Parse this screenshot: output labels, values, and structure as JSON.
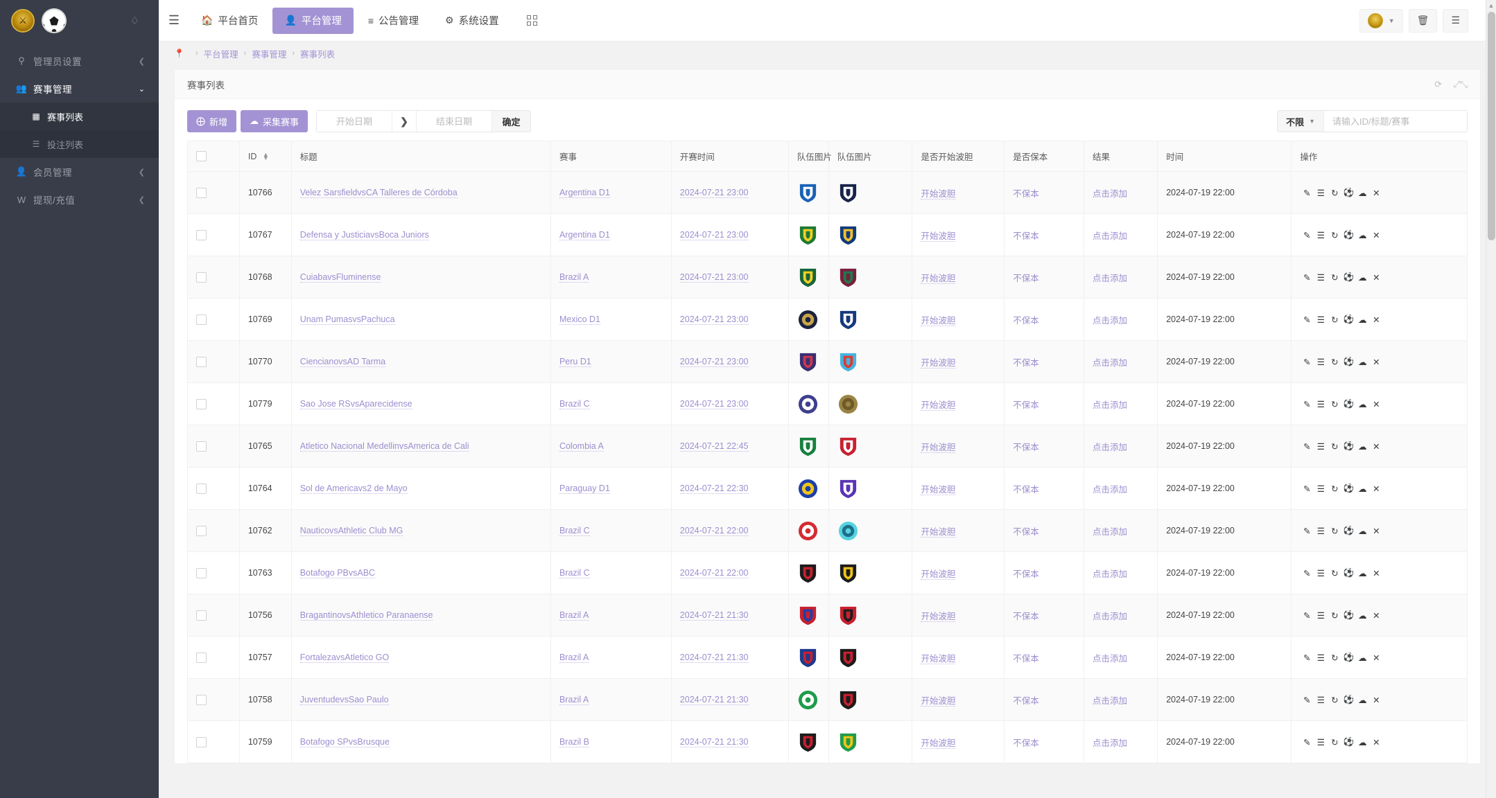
{
  "sidebar": {
    "logo": {
      "crest_icon": "shield-crest-icon",
      "ball_icon": "soccer-ball-icon",
      "drop_icon": "water-drop-icon"
    },
    "items": [
      {
        "label": "管理员设置",
        "icon": "key-icon",
        "arrow": "chevron-left-icon",
        "active": false
      },
      {
        "label": "赛事管理",
        "icon": "users-icon",
        "arrow": "chevron-down-icon",
        "active": true
      },
      {
        "label": "会员管理",
        "icon": "person-icon",
        "arrow": "chevron-left-icon",
        "active": false
      },
      {
        "label": "提现/充值",
        "icon": "wallet-icon",
        "arrow": "chevron-left-icon",
        "active": false
      }
    ],
    "submenu": [
      {
        "label": "赛事列表",
        "icon": "table-icon",
        "active": true
      },
      {
        "label": "投注列表",
        "icon": "list-icon",
        "active": false
      }
    ]
  },
  "topbar": {
    "menu_toggle_icon": "hamburger-icon",
    "tabs": [
      {
        "label": "平台首页",
        "icon": "home-icon",
        "selected": false
      },
      {
        "label": "平台管理",
        "icon": "user-icon",
        "selected": true
      },
      {
        "label": "公告管理",
        "icon": "announcement-icon",
        "selected": false
      },
      {
        "label": "系统设置",
        "icon": "gear-icon",
        "selected": false
      }
    ],
    "grid_icon": "grid-apps-icon",
    "right_buttons": [
      {
        "icon": "avatar-icon",
        "caret": "chevron-down-icon"
      },
      {
        "icon": "trash-icon"
      },
      {
        "icon": "list-lines-icon"
      }
    ]
  },
  "breadcrumb": {
    "pin_icon": "location-pin-icon",
    "items": [
      "平台管理",
      "赛事管理",
      "赛事列表"
    ]
  },
  "card": {
    "title": "赛事列表",
    "head_icons": [
      "refresh-icon",
      "expand-icon"
    ]
  },
  "toolbar": {
    "add_label": "新增",
    "add_icon": "plus-circle-icon",
    "collect_label": "采集赛事",
    "collect_icon": "cloud-download-icon",
    "start_date_placeholder": "开始日期",
    "start_date_value": "",
    "range_arrow_icon": "chevron-right-icon",
    "end_date_placeholder": "结束日期",
    "end_date_value": "",
    "confirm_label": "确定",
    "filter_select_label": "不限",
    "filter_caret_icon": "chevron-down-icon",
    "search_placeholder": "请输入ID/标题/赛事",
    "search_value": ""
  },
  "table": {
    "columns": [
      "ID",
      "标题",
      "赛事",
      "开赛时间",
      "队伍图片",
      "队伍图片",
      "是否开始波胆",
      "是否保本",
      "结果",
      "时间",
      "操作"
    ],
    "sort_column": "ID",
    "action_icons": [
      "edit-icon",
      "detail-list-icon",
      "refresh-icon",
      "soccer-ball-icon",
      "cloud-upload-icon",
      "close-icon"
    ],
    "rows": [
      {
        "id": "10766",
        "title": "Velez SarsfieldvsCA Talleres de Córdoba",
        "league": "Argentina D1",
        "kickoff": "2024-07-21 23:00",
        "bodan": "开始波胆",
        "baoben": "不保本",
        "result": "点击添加",
        "time": "2024-07-19 22:00",
        "home": "velez",
        "away": "talleres"
      },
      {
        "id": "10767",
        "title": "Defensa y JusticiavsBoca Juniors",
        "league": "Argentina D1",
        "kickoff": "2024-07-21 23:00",
        "bodan": "开始波胆",
        "baoben": "不保本",
        "result": "点击添加",
        "time": "2024-07-19 22:00",
        "home": "defensa",
        "away": "boca"
      },
      {
        "id": "10768",
        "title": "CuiabavsFluminense",
        "league": "Brazil A",
        "kickoff": "2024-07-21 23:00",
        "bodan": "开始波胆",
        "baoben": "不保本",
        "result": "点击添加",
        "time": "2024-07-19 22:00",
        "home": "cuiaba",
        "away": "fluminense"
      },
      {
        "id": "10769",
        "title": "Unam PumasvsPachuca",
        "league": "Mexico D1",
        "kickoff": "2024-07-21 23:00",
        "bodan": "开始波胆",
        "baoben": "不保本",
        "result": "点击添加",
        "time": "2024-07-19 22:00",
        "home": "pumas",
        "away": "pachuca"
      },
      {
        "id": "10770",
        "title": "CiencianovsAD Tarma",
        "league": "Peru D1",
        "kickoff": "2024-07-21 23:00",
        "bodan": "开始波胆",
        "baoben": "不保本",
        "result": "点击添加",
        "time": "2024-07-19 22:00",
        "home": "cienciano",
        "away": "adt"
      },
      {
        "id": "10779",
        "title": "Sao Jose RSvsAparecidense",
        "league": "Brazil C",
        "kickoff": "2024-07-21 23:00",
        "bodan": "开始波胆",
        "baoben": "不保本",
        "result": "点击添加",
        "time": "2024-07-19 22:00",
        "home": "saojose",
        "away": "aparecidense"
      },
      {
        "id": "10765",
        "title": "Atletico Nacional MedellinvsAmerica de Cali",
        "league": "Colombia A",
        "kickoff": "2024-07-21 22:45",
        "bodan": "开始波胆",
        "baoben": "不保本",
        "result": "点击添加",
        "time": "2024-07-19 22:00",
        "home": "nacional",
        "away": "americacali"
      },
      {
        "id": "10764",
        "title": "Sol de Americavs2 de Mayo",
        "league": "Paraguay D1",
        "kickoff": "2024-07-21 22:30",
        "bodan": "开始波胆",
        "baoben": "不保本",
        "result": "点击添加",
        "time": "2024-07-19 22:00",
        "home": "solamerica",
        "away": "dosmayo"
      },
      {
        "id": "10762",
        "title": "NauticovsAthletic Club MG",
        "league": "Brazil C",
        "kickoff": "2024-07-21 22:00",
        "bodan": "开始波胆",
        "baoben": "不保本",
        "result": "点击添加",
        "time": "2024-07-19 22:00",
        "home": "nautico",
        "away": "athleticmg"
      },
      {
        "id": "10763",
        "title": "Botafogo PBvsABC",
        "league": "Brazil C",
        "kickoff": "2024-07-21 22:00",
        "bodan": "开始波胆",
        "baoben": "不保本",
        "result": "点击添加",
        "time": "2024-07-19 22:00",
        "home": "botafogopb",
        "away": "abc"
      },
      {
        "id": "10756",
        "title": "BragantinovsAthletico Paranaense",
        "league": "Brazil A",
        "kickoff": "2024-07-21 21:30",
        "bodan": "开始波胆",
        "baoben": "不保本",
        "result": "点击添加",
        "time": "2024-07-19 22:00",
        "home": "bragantino",
        "away": "athletico"
      },
      {
        "id": "10757",
        "title": "FortalezavsAtletico GO",
        "league": "Brazil A",
        "kickoff": "2024-07-21 21:30",
        "bodan": "开始波胆",
        "baoben": "不保本",
        "result": "点击添加",
        "time": "2024-07-19 22:00",
        "home": "fortaleza",
        "away": "atleticogo"
      },
      {
        "id": "10758",
        "title": "JuventudevsSao Paulo",
        "league": "Brazil A",
        "kickoff": "2024-07-21 21:30",
        "bodan": "开始波胆",
        "baoben": "不保本",
        "result": "点击添加",
        "time": "2024-07-19 22:00",
        "home": "juventude",
        "away": "saopaulo"
      },
      {
        "id": "10759",
        "title": "Botafogo SPvsBrusque",
        "league": "Brazil B",
        "kickoff": "2024-07-21 21:30",
        "bodan": "开始波胆",
        "baoben": "不保本",
        "result": "点击添加",
        "time": "2024-07-19 22:00",
        "home": "botafogosp",
        "away": "brusque"
      }
    ]
  },
  "colors": {
    "accent": "#a393d4",
    "sidebar_bg": "#393d49",
    "link": "#9d8ecf"
  }
}
